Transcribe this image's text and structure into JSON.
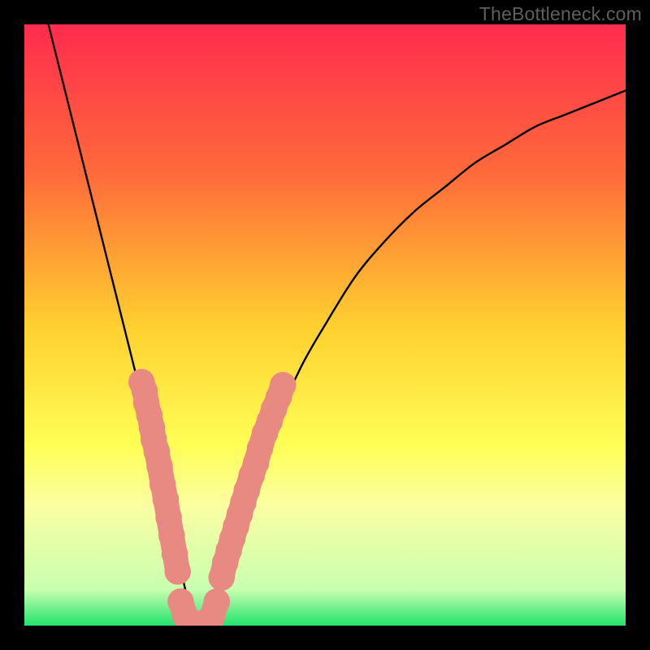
{
  "watermark": "TheBottleneck.com",
  "chart_data": {
    "type": "line",
    "title": "",
    "xlabel": "",
    "ylabel": "",
    "xlim": [
      0,
      100
    ],
    "ylim": [
      0,
      100
    ],
    "background_gradient": {
      "stops": [
        {
          "y": 0,
          "color": "#ff2b4e"
        },
        {
          "y": 25,
          "color": "#ff6b3a"
        },
        {
          "y": 50,
          "color": "#ffcf2f"
        },
        {
          "y": 70,
          "color": "#ffff55"
        },
        {
          "y": 80,
          "color": "#fbffa2"
        },
        {
          "y": 94,
          "color": "#c9ffb0"
        },
        {
          "y": 100,
          "color": "#22e36d"
        }
      ]
    },
    "series": [
      {
        "name": "bottleneck_curve",
        "color": "#000000",
        "x": [
          4,
          6,
          8,
          10,
          12,
          14,
          16,
          18,
          20,
          22,
          24,
          25.5,
          27,
          28.5,
          30,
          32,
          35,
          38,
          42,
          46,
          50,
          55,
          60,
          65,
          70,
          75,
          80,
          85,
          90,
          95,
          100
        ],
        "y": [
          100,
          92,
          84,
          76,
          68,
          60,
          52,
          44,
          36,
          28,
          20,
          12,
          5,
          0,
          0,
          5,
          14,
          23,
          34,
          43,
          50,
          58,
          64,
          69,
          73,
          77,
          80,
          83,
          85,
          87,
          89
        ]
      }
    ],
    "markers": {
      "color": "#e98a82",
      "radius": 2.2,
      "clusters": [
        {
          "name": "left_descent_cluster",
          "points": [
            {
              "x": 19.5,
              "y": 40.5
            },
            {
              "x": 20.0,
              "y": 39.0
            },
            {
              "x": 20.3,
              "y": 37.0
            },
            {
              "x": 20.8,
              "y": 35.0
            },
            {
              "x": 21.2,
              "y": 33.0
            },
            {
              "x": 21.5,
              "y": 31.0
            },
            {
              "x": 22.0,
              "y": 29.0
            },
            {
              "x": 22.5,
              "y": 26.5
            },
            {
              "x": 23.0,
              "y": 23.5
            },
            {
              "x": 23.5,
              "y": 21.0
            },
            {
              "x": 24.0,
              "y": 18.0
            },
            {
              "x": 24.5,
              "y": 15.0
            },
            {
              "x": 25.0,
              "y": 12.0
            },
            {
              "x": 25.5,
              "y": 9.0
            }
          ]
        },
        {
          "name": "bottom_cluster",
          "points": [
            {
              "x": 26.0,
              "y": 4.0
            },
            {
              "x": 26.8,
              "y": 1.5
            },
            {
              "x": 27.5,
              "y": 0.5
            },
            {
              "x": 28.3,
              "y": 0.3
            },
            {
              "x": 29.0,
              "y": 0.3
            },
            {
              "x": 29.8,
              "y": 0.3
            },
            {
              "x": 30.5,
              "y": 0.5
            },
            {
              "x": 31.2,
              "y": 1.5
            },
            {
              "x": 32.0,
              "y": 4.0
            }
          ]
        },
        {
          "name": "right_ascent_cluster",
          "points": [
            {
              "x": 32.8,
              "y": 8.0
            },
            {
              "x": 33.4,
              "y": 10.5
            },
            {
              "x": 34.0,
              "y": 12.5
            },
            {
              "x": 34.6,
              "y": 14.5
            },
            {
              "x": 35.2,
              "y": 16.5
            },
            {
              "x": 35.8,
              "y": 18.5
            },
            {
              "x": 36.4,
              "y": 20.5
            },
            {
              "x": 37.0,
              "y": 22.5
            },
            {
              "x": 37.8,
              "y": 25.0
            },
            {
              "x": 38.5,
              "y": 27.0
            },
            {
              "x": 39.2,
              "y": 29.5
            },
            {
              "x": 40.0,
              "y": 32.0
            },
            {
              "x": 40.8,
              "y": 34.0
            },
            {
              "x": 41.5,
              "y": 36.0
            },
            {
              "x": 42.3,
              "y": 38.0
            },
            {
              "x": 43.0,
              "y": 40.0
            }
          ]
        }
      ]
    }
  }
}
